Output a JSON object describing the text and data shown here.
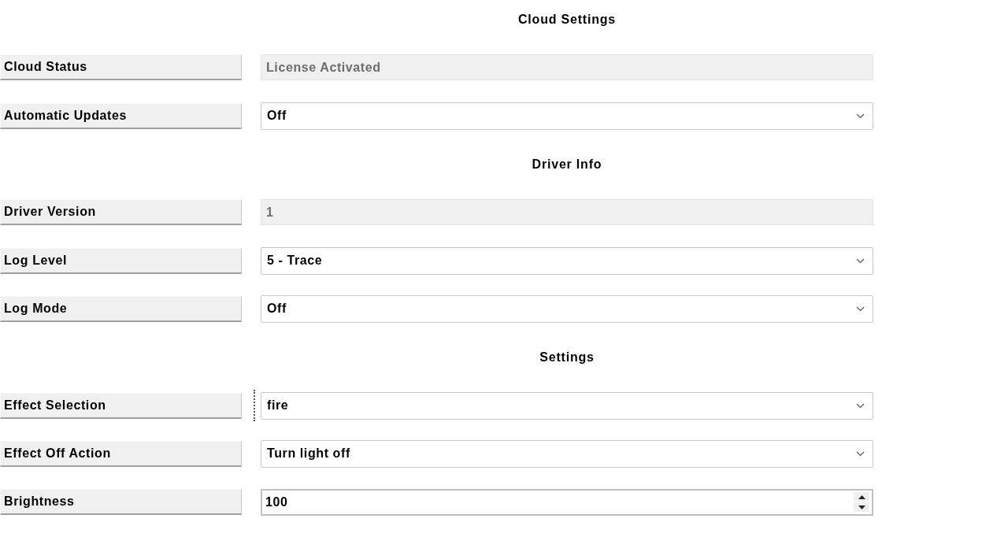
{
  "sections": [
    {
      "title": "Cloud Settings",
      "rows": [
        {
          "label": "Cloud Status",
          "kind": "readonly",
          "value": "License Activated",
          "focused": false
        },
        {
          "label": "Automatic Updates",
          "kind": "dropdown",
          "value": "Off",
          "focused": false
        }
      ]
    },
    {
      "title": "Driver Info",
      "rows": [
        {
          "label": "Driver Version",
          "kind": "readonly",
          "value": "1",
          "focused": false
        },
        {
          "label": "Log Level",
          "kind": "dropdown",
          "value": "5 - Trace",
          "focused": false
        },
        {
          "label": "Log Mode",
          "kind": "dropdown",
          "value": "Off",
          "focused": false
        }
      ]
    },
    {
      "title": "Settings",
      "rows": [
        {
          "label": "Effect Selection",
          "kind": "dropdown",
          "value": "fire",
          "focused": true
        },
        {
          "label": "Effect Off Action",
          "kind": "dropdown",
          "value": "Turn light off",
          "focused": false
        },
        {
          "label": "Brightness",
          "kind": "spinner",
          "value": "100",
          "focused": false
        }
      ]
    }
  ]
}
